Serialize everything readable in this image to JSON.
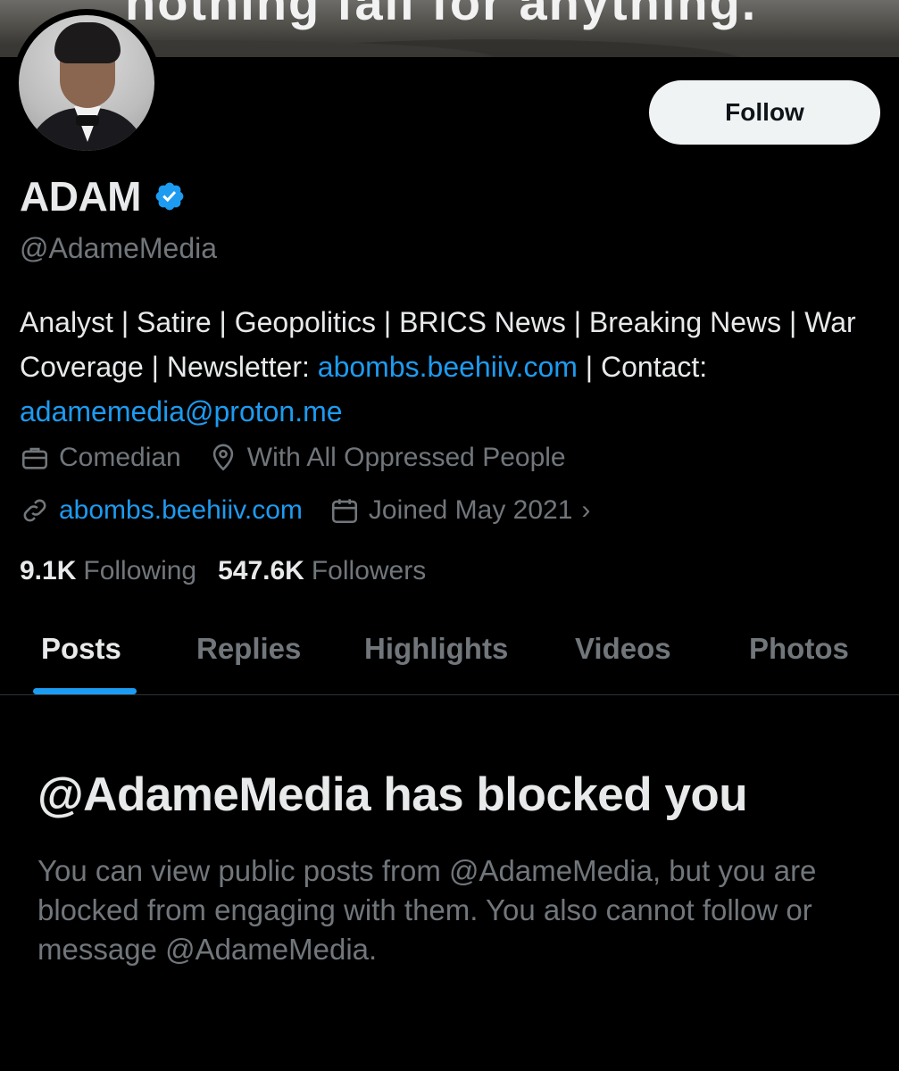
{
  "banner": {
    "text": "nothing fall for anything."
  },
  "profile": {
    "name": "ADAM",
    "handle": "@AdameMedia",
    "follow_label": "Follow",
    "bio": {
      "part1": "Analyst | Satire | Geopolitics | BRICS News | Breaking News | War Coverage | Newsletter: ",
      "link1": "abombs.beehiiv.com",
      "part2": " | Contact: ",
      "link2": "adamemedia@proton.me"
    },
    "category": "Comedian",
    "location": "With All Oppressed People",
    "website": "abombs.beehiiv.com",
    "joined": "Joined May 2021",
    "following_count": "9.1K",
    "following_label": "Following",
    "followers_count": "547.6K",
    "followers_label": "Followers"
  },
  "tabs": [
    "Posts",
    "Replies",
    "Highlights",
    "Videos",
    "Photos"
  ],
  "blocked": {
    "title": "@AdameMedia has blocked you",
    "description": "You can view public posts from @AdameMedia, but you are blocked from engaging with them. You also cannot follow or message @AdameMedia."
  },
  "icons": {
    "verified": "verified-badge-icon",
    "category": "briefcase-icon",
    "location": "location-pin-icon",
    "website": "link-icon",
    "joined": "calendar-icon",
    "chevron": "chevron-right-icon"
  },
  "colors": {
    "accent": "#1d9bf0",
    "secondary_text": "#71767b",
    "background": "#000000"
  }
}
